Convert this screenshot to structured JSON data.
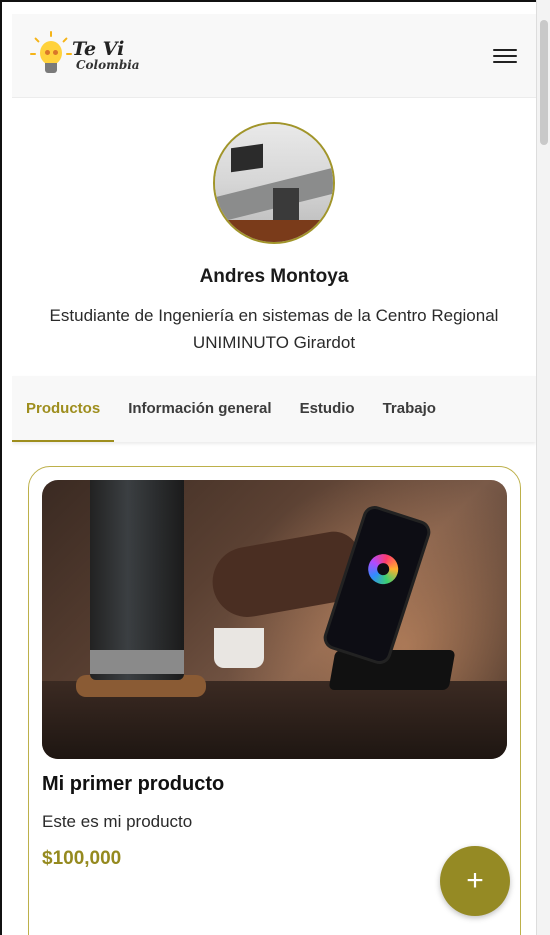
{
  "header": {
    "logo_line1": "Te Vi",
    "logo_line2": "Colombia"
  },
  "profile": {
    "name": "Andres Montoya",
    "bio": "Estudiante de Ingeniería en sistemas de la Centro Regional UNIMINUTO Girardot"
  },
  "tabs": [
    {
      "label": "Productos",
      "active": true
    },
    {
      "label": "Información general",
      "active": false
    },
    {
      "label": "Estudio",
      "active": false
    },
    {
      "label": "Trabajo",
      "active": false
    }
  ],
  "product": {
    "title": "Mi primer producto",
    "description": "Este es mi producto",
    "price": "$100,000"
  },
  "fab": {
    "label": "+"
  },
  "colors": {
    "accent": "#9e8e1e",
    "card_border": "#bdb04a",
    "fab": "#958a24"
  },
  "icons": [
    "menu-icon",
    "lightbulb-logo-icon",
    "add-icon"
  ]
}
